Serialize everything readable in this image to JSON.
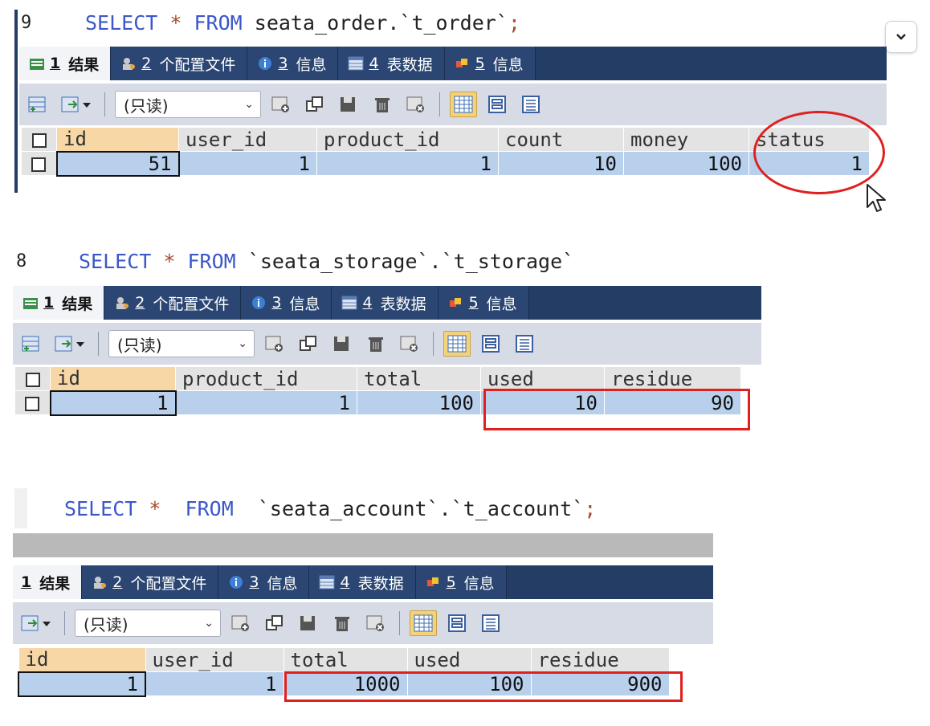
{
  "tabs": {
    "result": "结果",
    "config": "个配置文件",
    "info": "信息",
    "tabledata": "表数据",
    "info2": "信息",
    "n1": "1",
    "n2": "2",
    "n3": "3",
    "n4": "4",
    "n5": "5"
  },
  "toolbar": {
    "mode": "(只读)"
  },
  "query1": {
    "lineno": "9",
    "kw_select": "SELECT",
    "star": "*",
    "kw_from": "FROM",
    "rest": "seata_order.`t_order`",
    "semicolon": ";",
    "columns": [
      "id",
      "user_id",
      "product_id",
      "count",
      "money",
      "status"
    ],
    "row": [
      "51",
      "1",
      "1",
      "10",
      "100",
      "1"
    ]
  },
  "query2": {
    "lineno": "8",
    "kw_select": "SELECT",
    "star": "*",
    "kw_from": "FROM",
    "rest": "`seata_storage`.`t_storage`",
    "columns": [
      "id",
      "product_id",
      "total",
      "used",
      "residue"
    ],
    "row": [
      "1",
      "1",
      "100",
      "10",
      "90"
    ]
  },
  "query3": {
    "kw_select": "SELECT",
    "star": "*",
    "kw_from": "FROM",
    "rest": "`seata_account`.`t_account`",
    "semicolon": ";",
    "columns": [
      "id",
      "user_id",
      "total",
      "used",
      "residue"
    ],
    "row": [
      "1",
      "1",
      "1000",
      "100",
      "900"
    ]
  },
  "colors": {
    "tabbar": "#233d65",
    "highlight": "#e0201f",
    "cell": "#b8d0ec"
  }
}
